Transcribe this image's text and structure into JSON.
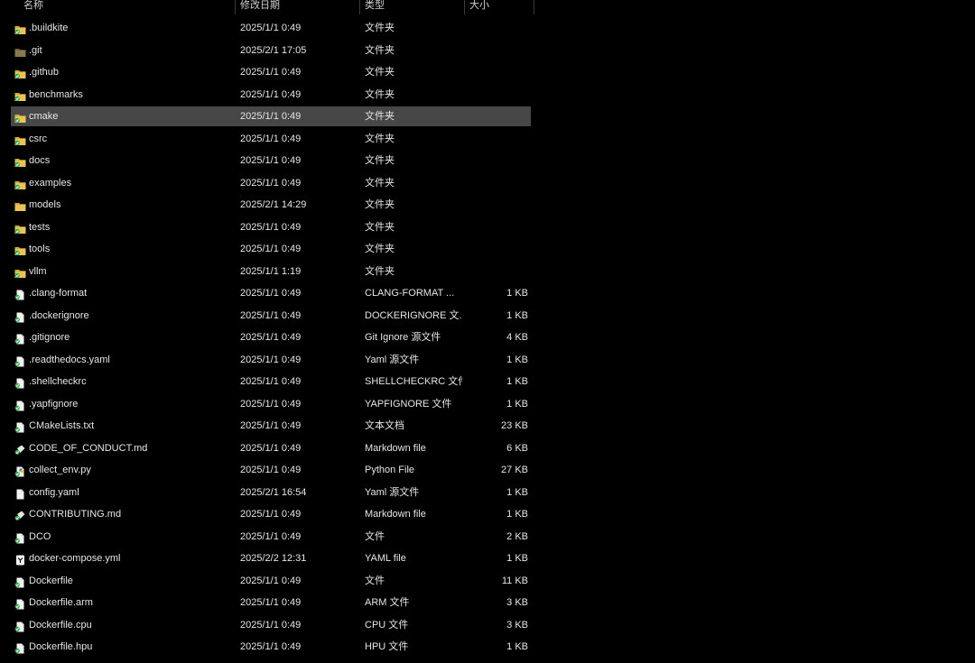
{
  "header": {
    "name": "名称",
    "date": "修改日期",
    "type": "类型",
    "size": "大小"
  },
  "selected_index": 4,
  "files": [
    {
      "name": ".buildkite",
      "date": "2025/1/1 0:49",
      "type": "文件夹",
      "size": "",
      "icon": "folder-sync-icon"
    },
    {
      "name": ".git",
      "date": "2025/2/1 17:05",
      "type": "文件夹",
      "size": "",
      "icon": "folder-hidden-icon"
    },
    {
      "name": ".github",
      "date": "2025/1/1 0:49",
      "type": "文件夹",
      "size": "",
      "icon": "folder-sync-icon"
    },
    {
      "name": "benchmarks",
      "date": "2025/1/1 0:49",
      "type": "文件夹",
      "size": "",
      "icon": "folder-sync-icon"
    },
    {
      "name": "cmake",
      "date": "2025/1/1 0:49",
      "type": "文件夹",
      "size": "",
      "icon": "folder-sync-icon"
    },
    {
      "name": "csrc",
      "date": "2025/1/1 0:49",
      "type": "文件夹",
      "size": "",
      "icon": "folder-sync-icon"
    },
    {
      "name": "docs",
      "date": "2025/1/1 0:49",
      "type": "文件夹",
      "size": "",
      "icon": "folder-sync-icon"
    },
    {
      "name": "examples",
      "date": "2025/1/1 0:49",
      "type": "文件夹",
      "size": "",
      "icon": "folder-sync-icon"
    },
    {
      "name": "models",
      "date": "2025/2/1 14:29",
      "type": "文件夹",
      "size": "",
      "icon": "folder-icon"
    },
    {
      "name": "tests",
      "date": "2025/1/1 0:49",
      "type": "文件夹",
      "size": "",
      "icon": "folder-sync-icon"
    },
    {
      "name": "tools",
      "date": "2025/1/1 0:49",
      "type": "文件夹",
      "size": "",
      "icon": "folder-sync-icon"
    },
    {
      "name": "vllm",
      "date": "2025/1/1 1:19",
      "type": "文件夹",
      "size": "",
      "icon": "folder-sync-icon"
    },
    {
      "name": ".clang-format",
      "date": "2025/1/1 0:49",
      "type": "CLANG-FORMAT ...",
      "size": "1 KB",
      "icon": "file-sync-icon"
    },
    {
      "name": ".dockerignore",
      "date": "2025/1/1 0:49",
      "type": "DOCKERIGNORE 文...",
      "size": "1 KB",
      "icon": "file-sync-icon"
    },
    {
      "name": ".gitignore",
      "date": "2025/1/1 0:49",
      "type": "Git Ignore 源文件",
      "size": "4 KB",
      "icon": "file-sync-icon"
    },
    {
      "name": ".readthedocs.yaml",
      "date": "2025/1/1 0:49",
      "type": "Yaml 源文件",
      "size": "1 KB",
      "icon": "file-sync-icon"
    },
    {
      "name": ".shellcheckrc",
      "date": "2025/1/1 0:49",
      "type": "SHELLCHECKRC 文件",
      "size": "1 KB",
      "icon": "file-sync-icon"
    },
    {
      "name": ".yapfignore",
      "date": "2025/1/1 0:49",
      "type": "YAPFIGNORE 文件",
      "size": "1 KB",
      "icon": "file-sync-icon"
    },
    {
      "name": "CMakeLists.txt",
      "date": "2025/1/1 0:49",
      "type": "文本文档",
      "size": "23 KB",
      "icon": "file-sync-icon"
    },
    {
      "name": "CODE_OF_CONDUCT.md",
      "date": "2025/1/1 0:49",
      "type": "Markdown file",
      "size": "6 KB",
      "icon": "markdown-file-icon"
    },
    {
      "name": "collect_env.py",
      "date": "2025/1/1 0:49",
      "type": "Python File",
      "size": "27 KB",
      "icon": "python-file-icon"
    },
    {
      "name": "config.yaml",
      "date": "2025/2/1 16:54",
      "type": "Yaml 源文件",
      "size": "1 KB",
      "icon": "file-icon"
    },
    {
      "name": "CONTRIBUTING.md",
      "date": "2025/1/1 0:49",
      "type": "Markdown file",
      "size": "1 KB",
      "icon": "markdown-file-icon"
    },
    {
      "name": "DCO",
      "date": "2025/1/1 0:49",
      "type": "文件",
      "size": "2 KB",
      "icon": "file-sync-icon"
    },
    {
      "name": "docker-compose.yml",
      "date": "2025/2/2 12:31",
      "type": "YAML file",
      "size": "1 KB",
      "icon": "yaml-file-icon"
    },
    {
      "name": "Dockerfile",
      "date": "2025/1/1 0:49",
      "type": "文件",
      "size": "11 KB",
      "icon": "file-sync-icon"
    },
    {
      "name": "Dockerfile.arm",
      "date": "2025/1/1 0:49",
      "type": "ARM 文件",
      "size": "3 KB",
      "icon": "file-sync-icon"
    },
    {
      "name": "Dockerfile.cpu",
      "date": "2025/1/1 0:49",
      "type": "CPU 文件",
      "size": "3 KB",
      "icon": "file-sync-icon"
    },
    {
      "name": "Dockerfile.hpu",
      "date": "2025/1/1 0:49",
      "type": "HPU 文件",
      "size": "1 KB",
      "icon": "file-sync-icon"
    }
  ]
}
